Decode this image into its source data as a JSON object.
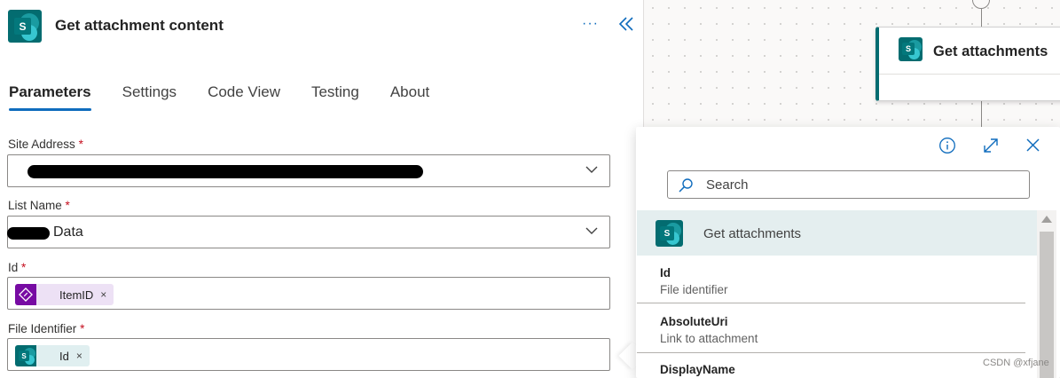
{
  "panel": {
    "title": "Get attachment content",
    "more_glyph": "···",
    "tabs": [
      {
        "label": "Parameters",
        "active": true
      },
      {
        "label": "Settings"
      },
      {
        "label": "Code View"
      },
      {
        "label": "Testing"
      },
      {
        "label": "About"
      }
    ],
    "fields": {
      "site_address": {
        "label": "Site Address",
        "required_mark": "*"
      },
      "list_name": {
        "label": "List Name",
        "required_mark": "*",
        "value_visible": "Data"
      },
      "id": {
        "label": "Id",
        "required_mark": "*",
        "token": {
          "label": "ItemID",
          "remove": "×"
        }
      },
      "file_identifier": {
        "label": "File Identifier",
        "required_mark": "*",
        "token": {
          "label": "Id",
          "remove": "×"
        }
      }
    },
    "icon_letter": "S"
  },
  "canvas": {
    "action_card": {
      "title": "Get attachments",
      "icon_letter": "S"
    }
  },
  "flyout": {
    "search": {
      "placeholder": "Search"
    },
    "group": {
      "label": "Get attachments",
      "icon_letter": "S"
    },
    "items": [
      {
        "name": "Id",
        "description": "File identifier"
      },
      {
        "name": "AbsoluteUri",
        "description": "Link to attachment"
      },
      {
        "name": "DisplayName",
        "description": ""
      }
    ]
  },
  "watermark": "CSDN @xfjane",
  "colors": {
    "accent": "#0f6cbd",
    "sharepoint_teal": "#036c70",
    "variable_purple": "#770ba3",
    "required_red": "#c50f1f"
  }
}
